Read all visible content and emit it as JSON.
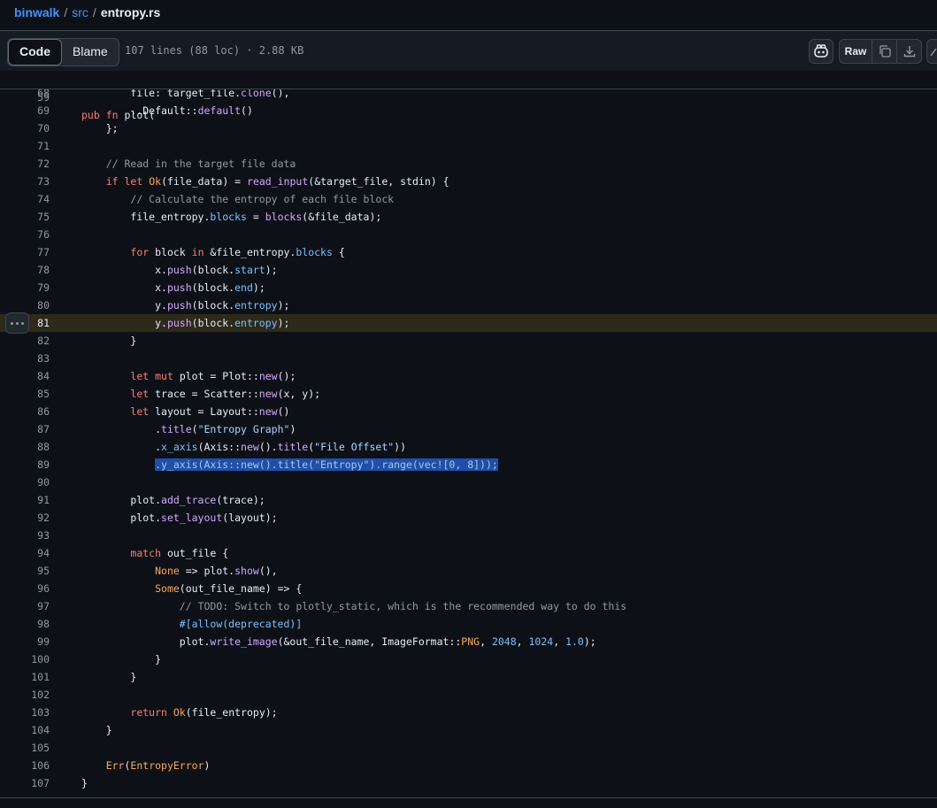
{
  "breadcrumb": {
    "repo": "binwalk",
    "folder": "src",
    "file": "entropy.rs"
  },
  "toolbar": {
    "code_tab": "Code",
    "blame_tab": "Blame",
    "file_meta": "107 lines (88 loc) · 2.88 KB",
    "raw_label": "Raw"
  },
  "sticky": {
    "number": "59",
    "text": "pub fn plot("
  },
  "lines": [
    {
      "n": "68",
      "t": "        file: target_file.clone(),"
    },
    {
      "n": "69",
      "t": "        ..Default::default()"
    },
    {
      "n": "70",
      "t": "    };"
    },
    {
      "n": "71",
      "t": ""
    },
    {
      "n": "72",
      "t": "    // Read in the target file data"
    },
    {
      "n": "73",
      "t": "    if let Ok(file_data) = read_input(&target_file, stdin) {"
    },
    {
      "n": "74",
      "t": "        // Calculate the entropy of each file block"
    },
    {
      "n": "75",
      "t": "        file_entropy.blocks = blocks(&file_data);"
    },
    {
      "n": "76",
      "t": ""
    },
    {
      "n": "77",
      "t": "        for block in &file_entropy.blocks {"
    },
    {
      "n": "78",
      "t": "            x.push(block.start);"
    },
    {
      "n": "79",
      "t": "            x.push(block.end);"
    },
    {
      "n": "80",
      "t": "            y.push(block.entropy);"
    },
    {
      "n": "81",
      "t": "            y.push(block.entropy);"
    },
    {
      "n": "82",
      "t": "        }"
    },
    {
      "n": "83",
      "t": ""
    },
    {
      "n": "84",
      "t": "        let mut plot = Plot::new();"
    },
    {
      "n": "85",
      "t": "        let trace = Scatter::new(x, y);"
    },
    {
      "n": "86",
      "t": "        let layout = Layout::new()"
    },
    {
      "n": "87",
      "t": "            .title(\"Entropy Graph\")"
    },
    {
      "n": "88",
      "t": "            .x_axis(Axis::new().title(\"File Offset\"))"
    },
    {
      "n": "89",
      "t": "            .y_axis(Axis::new().title(\"Entropy\").range(vec![0, 8]));"
    },
    {
      "n": "90",
      "t": ""
    },
    {
      "n": "91",
      "t": "        plot.add_trace(trace);"
    },
    {
      "n": "92",
      "t": "        plot.set_layout(layout);"
    },
    {
      "n": "93",
      "t": ""
    },
    {
      "n": "94",
      "t": "        match out_file {"
    },
    {
      "n": "95",
      "t": "            None => plot.show(),"
    },
    {
      "n": "96",
      "t": "            Some(out_file_name) => {"
    },
    {
      "n": "97",
      "t": "                // TODO: Switch to plotly_static, which is the recommended way to do this"
    },
    {
      "n": "98",
      "t": "                #[allow(deprecated)]"
    },
    {
      "n": "99",
      "t": "                plot.write_image(&out_file_name, ImageFormat::PNG, 2048, 1024, 1.0);"
    },
    {
      "n": "100",
      "t": "            }"
    },
    {
      "n": "101",
      "t": "        }"
    },
    {
      "n": "102",
      "t": ""
    },
    {
      "n": "103",
      "t": "        return Ok(file_entropy);"
    },
    {
      "n": "104",
      "t": "    }"
    },
    {
      "n": "105",
      "t": ""
    },
    {
      "n": "106",
      "t": "    Err(EntropyError)"
    },
    {
      "n": "107",
      "t": "}"
    }
  ],
  "icons": {
    "copilot": "copilot-icon",
    "copy": "copy-icon",
    "download": "download-icon",
    "more": "kebab-icon"
  },
  "colors": {
    "background": "#0d1117",
    "link": "#4493f8",
    "selection": "#1f4fa8",
    "highlight": "#2e2a1b"
  }
}
